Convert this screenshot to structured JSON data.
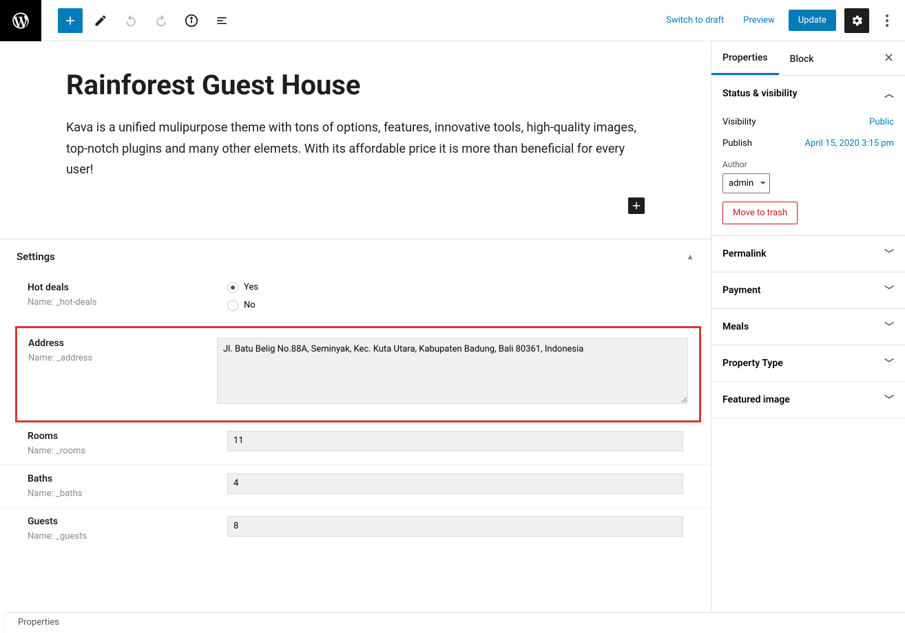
{
  "topbar": {
    "switch_to_draft": "Switch to draft",
    "preview": "Preview",
    "update": "Update"
  },
  "post": {
    "title": "Rainforest Guest House",
    "description": "Kava is a unified mulipurpose theme with tons of options, features, innovative tools, high-quality images, top-notch plugins and many other elemets. With its affordable price it is more than beneficial for every user!"
  },
  "settings": {
    "header": "Settings",
    "hotdeals": {
      "label": "Hot deals",
      "name": "Name: _hot-deals",
      "yes": "Yes",
      "no": "No"
    },
    "address": {
      "label": "Address",
      "name": "Name: _address",
      "value": "Jl. Batu Belig No.88A, Seminyak, Kec. Kuta Utara, Kabupaten Badung, Bali 80361, Indonesia"
    },
    "rooms": {
      "label": "Rooms",
      "name": "Name: _rooms",
      "value": "11"
    },
    "baths": {
      "label": "Baths",
      "name": "Name: _baths",
      "value": "4"
    },
    "guests": {
      "label": "Guests",
      "name": "Name: _guests",
      "value": "8"
    }
  },
  "sidebar": {
    "tabs": {
      "properties": "Properties",
      "block": "Block"
    },
    "status": {
      "header": "Status & visibility",
      "visibility_label": "Visibility",
      "visibility_value": "Public",
      "publish_label": "Publish",
      "publish_value": "April 15, 2020 3:15 pm",
      "author_label": "Author",
      "author_value": "admin",
      "trash": "Move to trash"
    },
    "panels": {
      "permalink": "Permalink",
      "payment": "Payment",
      "meals": "Meals",
      "property_type": "Property Type",
      "featured_image": "Featured image"
    }
  },
  "footer": {
    "crumb": "Properties"
  }
}
